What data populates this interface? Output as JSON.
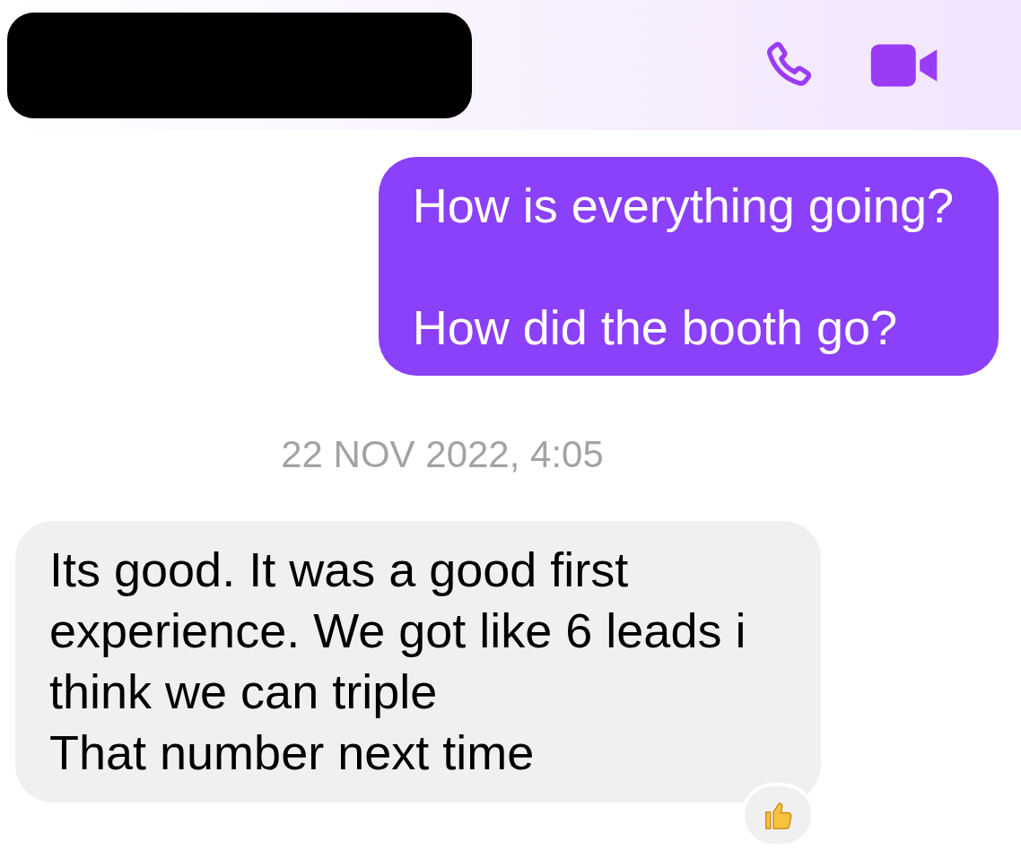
{
  "header": {
    "name_redacted": true
  },
  "messages": [
    {
      "kind": "sent",
      "text": "How is everything going?\n\nHow did the booth go?"
    },
    {
      "kind": "timestamp",
      "text": "22 NOV 2022, 4:05"
    },
    {
      "kind": "received",
      "text": "Its good. It was a good first experience. We got like 6 leads i think we can triple\nThat number next time",
      "reaction": true
    }
  ]
}
